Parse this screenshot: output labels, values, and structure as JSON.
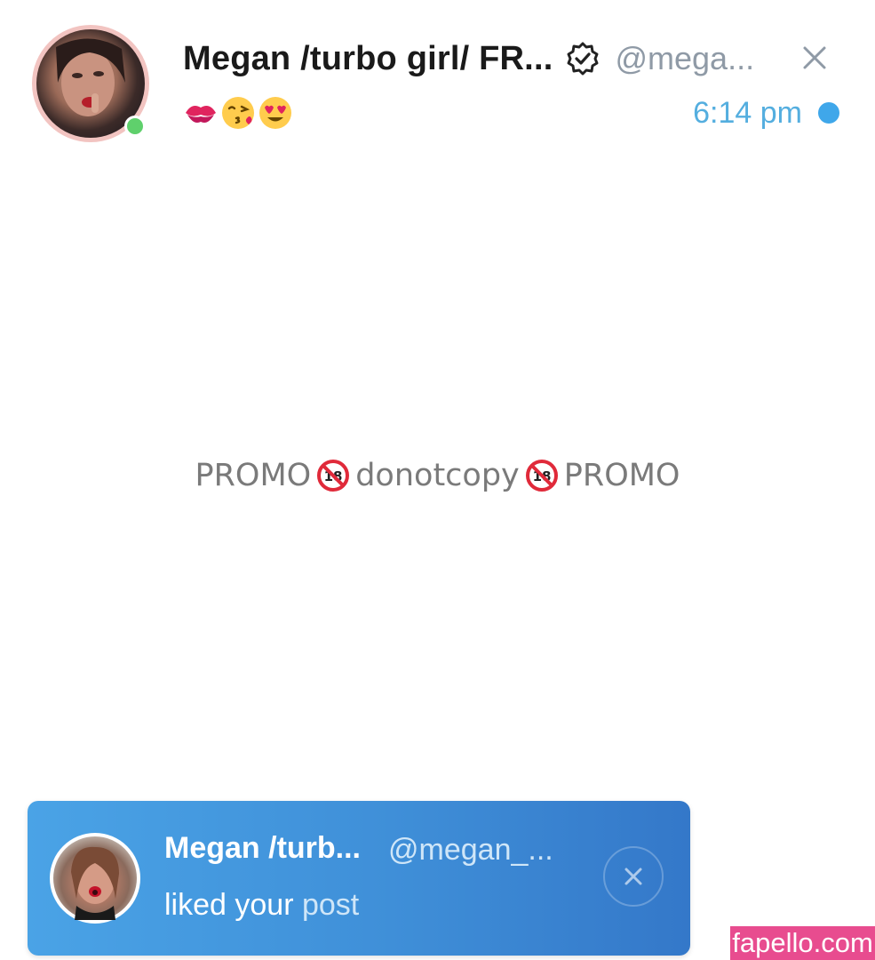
{
  "header": {
    "display_name": "Megan /turbo girl/ FR...",
    "handle": "@mega...",
    "status_emojis": [
      "kiss-mark",
      "face-blowing-kiss",
      "smiling-face-with-heart-eyes"
    ],
    "time": "6:14 pm",
    "online": true,
    "unread": true,
    "icons": {
      "verified": "verified-badge-icon",
      "close": "close-icon"
    }
  },
  "body": {
    "watermark": {
      "left": "PROMO ",
      "middle": "donotcopy",
      "right": "PROMO",
      "icon": "no-under-18-icon"
    }
  },
  "toast": {
    "name": "Megan /turb...",
    "handle": "@megan_...",
    "message_prefix": "liked your ",
    "message_link": "post"
  },
  "site_badge": "fapello.com",
  "colors": {
    "accent": "#3fa7ea",
    "time": "#54aedf",
    "online": "#5fd06c",
    "toast_start": "#4aa3e6",
    "toast_end": "#3478c9",
    "badge": "#e84c8f"
  }
}
